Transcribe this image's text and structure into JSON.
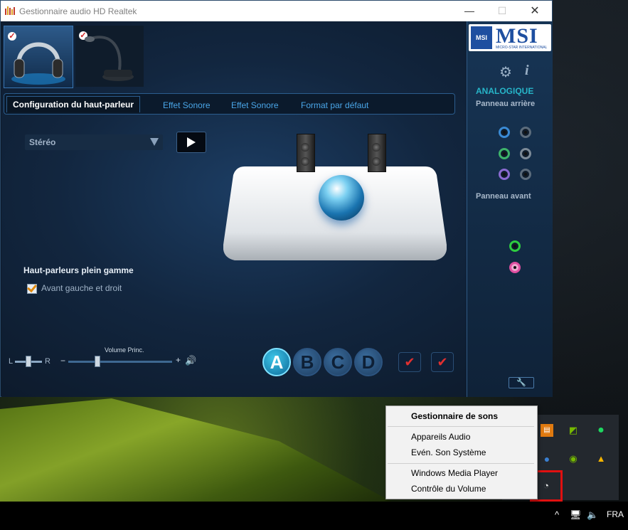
{
  "window": {
    "title": "Gestionnaire audio HD Realtek",
    "min_label": "—",
    "max_label": "☐",
    "close_label": "✕"
  },
  "devices": [
    {
      "name": "headphones",
      "checked": true,
      "check_label": "✓"
    },
    {
      "name": "microphone",
      "checked": true,
      "check_label": "✓"
    }
  ],
  "tabs": [
    {
      "label": "Configuration du haut-parleur",
      "active": true
    },
    {
      "label": "Effet Sonore",
      "active": false
    },
    {
      "label": "Effet Sonore",
      "active": false
    },
    {
      "label": "Format par défaut",
      "active": false
    }
  ],
  "config": {
    "speaker_mode": "Stéréo",
    "fullrange_heading": "Haut-parleurs plein gamme",
    "fullrange_option": "Avant gauche et droit",
    "fullrange_checked": true
  },
  "volume": {
    "balance_left": "L",
    "balance_right": "R",
    "title": "Volume Princ.",
    "minus": "−",
    "plus": "+",
    "speaker_icon": "🔊",
    "level": 0.25
  },
  "profiles": [
    "A",
    "B",
    "C",
    "D"
  ],
  "profile_active": "A",
  "right_panel": {
    "brand": "MSI",
    "brand_sub": "MICRO-STAR INTERNATIONAL",
    "shield_text": "MSI",
    "gear_icon": "⚙",
    "info_icon": "i",
    "analog_label": "ANALOGIQUE",
    "rear_label": "Panneau arrière",
    "front_label": "Panneau avant",
    "wrench_icon": "🔧",
    "jack_colors": {
      "blue": "#3a8ad4",
      "green": "#3db36a",
      "purple": "#8a6ad0",
      "gray": "#7c8a98",
      "pink": "#e04fa0",
      "front_green": "#2ecc40"
    }
  },
  "context_menu": {
    "items": [
      {
        "label": "Gestionnaire de sons",
        "bold": true
      },
      {
        "label": "Appareils Audio",
        "bold": false
      },
      {
        "label": "Evén. Son Système",
        "bold": false
      },
      {
        "label": "Windows Media Player",
        "bold": false
      },
      {
        "label": "Contrôle du Volume",
        "bold": false
      }
    ]
  },
  "tray": {
    "icons": [
      "storage-icon",
      "nvidia-ansel-icon",
      "spotify-icon",
      "blue-orb-icon",
      "nvidia-icon",
      "google-drive-icon",
      "realtek-speaker-icon"
    ]
  },
  "taskbar": {
    "chevron": "^",
    "language": "FRA",
    "volume_icon": "🔈",
    "network_icon": "🖥"
  },
  "colors": {
    "accent_teal": "#27b5c8",
    "tab_text": "#4aa6e8",
    "highlight_red": "#e01010"
  }
}
